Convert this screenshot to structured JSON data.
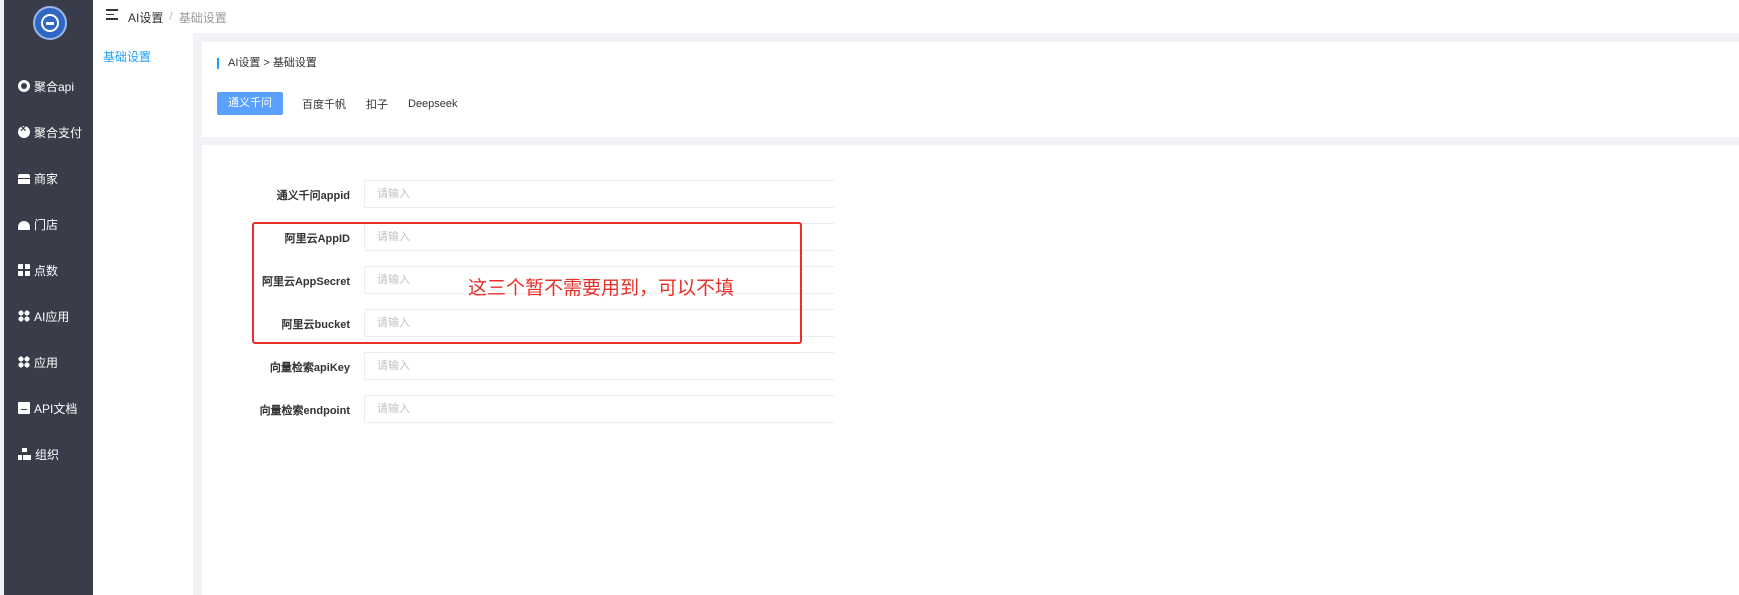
{
  "nav": {
    "items": [
      {
        "label": "聚合api",
        "icon": "api-circle-icon"
      },
      {
        "label": "聚合支付",
        "icon": "pay-circle-icon"
      },
      {
        "label": "商家",
        "icon": "shop-icon"
      },
      {
        "label": "门店",
        "icon": "store-icon"
      },
      {
        "label": "点数",
        "icon": "grid-icon"
      },
      {
        "label": "AI应用",
        "icon": "apps-icon"
      },
      {
        "label": "应用",
        "icon": "apps-icon"
      },
      {
        "label": "API文档",
        "icon": "doc-icon"
      },
      {
        "label": "组织",
        "icon": "org-icon"
      }
    ]
  },
  "header": {
    "breadcrumb": {
      "root": "AI设置",
      "separator": "/",
      "current": "基础设置"
    }
  },
  "subnav": {
    "items": [
      {
        "label": "基础设置"
      }
    ]
  },
  "card": {
    "title": "AI设置 > 基础设置",
    "tabs": [
      {
        "label": "通义千问",
        "active": true
      },
      {
        "label": "百度千帆",
        "active": false
      },
      {
        "label": "扣子",
        "active": false
      },
      {
        "label": "Deepseek",
        "active": false
      }
    ]
  },
  "form": {
    "fields": [
      {
        "label": "通义千问appid",
        "value": "",
        "placeholder": "请输入"
      },
      {
        "label": "阿里云AppID",
        "value": "",
        "placeholder": "请输入"
      },
      {
        "label": "阿里云AppSecret",
        "value": "",
        "placeholder": "请输入"
      },
      {
        "label": "阿里云bucket",
        "value": "",
        "placeholder": "请输入"
      },
      {
        "label": "向量检索apiKey",
        "value": "",
        "placeholder": "请输入"
      },
      {
        "label": "向量检索endpoint",
        "value": "",
        "placeholder": "请输入"
      }
    ]
  },
  "annotation": {
    "text": "这三个暂不需要用到，可以不填",
    "color": "#e8302a"
  },
  "colors": {
    "accent": "#1e9fff",
    "tab_active": "#5aa1ff",
    "nav_bg": "#393d49"
  }
}
